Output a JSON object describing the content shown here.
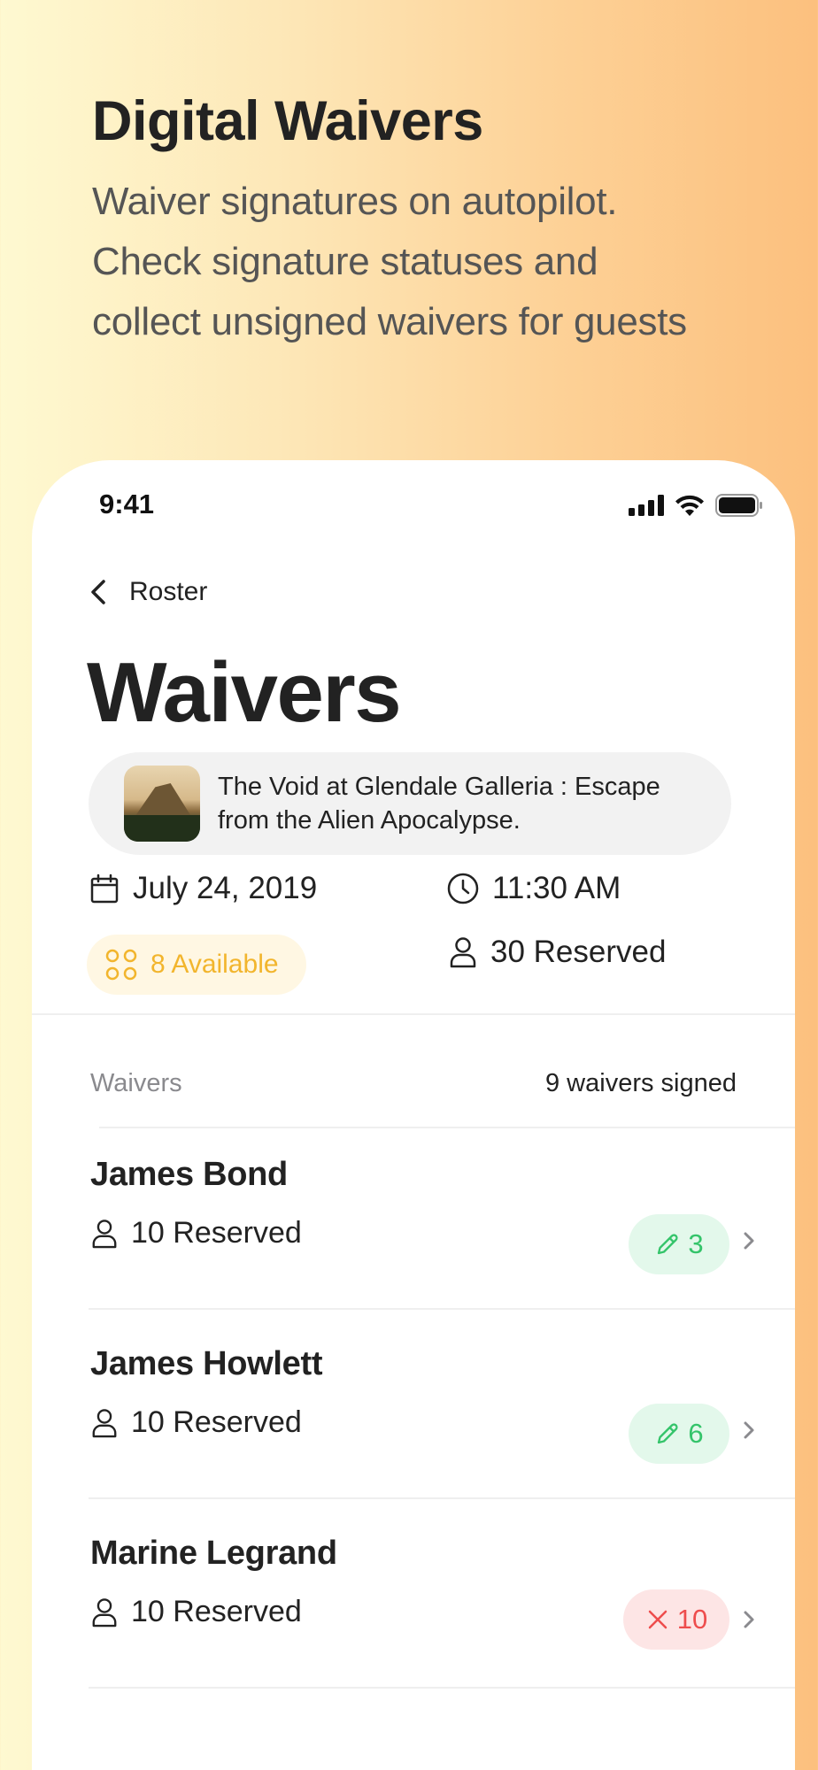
{
  "hero": {
    "title": "Digital Waivers",
    "subtitle_line1": "Waiver signatures on autopilot.",
    "subtitle_line2": "Check signature statuses and",
    "subtitle_line3": "collect unsigned waivers for guests"
  },
  "status_bar": {
    "time": "9:41"
  },
  "nav": {
    "back_label": "Roster"
  },
  "page": {
    "title": "Waivers"
  },
  "event": {
    "name": "The Void at Glendale Galleria : Escape from the Alien Apocalypse.",
    "date": "July 24, 2019",
    "time": "11:30 AM",
    "available": "8 Available",
    "reserved": "30 Reserved"
  },
  "waivers": {
    "header_label": "Waivers",
    "signed_count": "9 waivers signed",
    "rows": [
      {
        "name": "James Bond",
        "reserved": "10 Reserved",
        "badge": "3",
        "badge_type": "signed"
      },
      {
        "name": "James Howlett",
        "reserved": "10 Reserved",
        "badge": "6",
        "badge_type": "signed"
      },
      {
        "name": "Marine Legrand",
        "reserved": "10 Reserved",
        "badge": "10",
        "badge_type": "unsigned"
      }
    ]
  },
  "colors": {
    "accent_yellow": "#f2b52d",
    "signed_green": "#34c46a",
    "unsigned_red": "#ee4d4d"
  }
}
